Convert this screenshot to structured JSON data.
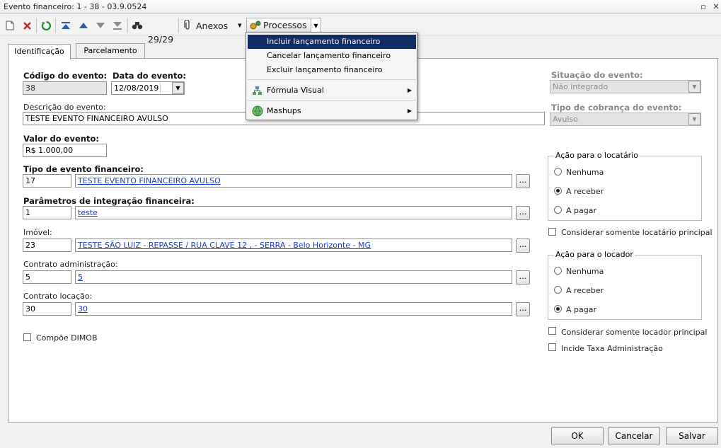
{
  "window": {
    "title": "Evento financeiro: 1 - 38 - 03.9.0524",
    "restore_glyph": "▫",
    "close_glyph": "✕"
  },
  "toolbar": {
    "record_position": "29/29",
    "attachments_label": "Anexos",
    "processes_label": "Processos"
  },
  "tabs": [
    "Identificação",
    "Parcelamento"
  ],
  "menu": {
    "items": [
      "Incluir lançamento financeiro",
      "Cancelar lançamento financeiro",
      "Excluir lançamento financeiro",
      "Fórmula Visual",
      "Mashups"
    ]
  },
  "form": {
    "codigo_label": "Código do evento:",
    "codigo_value": "38",
    "data_label": "Data do evento:",
    "data_value": "12/08/2019",
    "descricao_label": "Descrição do evento:",
    "descricao_value": "TESTE EVENTO FINANCEIRO AVULSO",
    "valor_label": "Valor do evento:",
    "valor_value": "R$ 1.000,00",
    "tipo_label": "Tipo de evento financeiro:",
    "tipo_code": "17",
    "tipo_desc": "TESTE EVENTO FINANCEIRO AVULSO",
    "param_label": "Parâmetros de integração financeira:",
    "param_code": "1",
    "param_desc": "teste",
    "imovel_label": "Imóvel:",
    "imovel_code": "23",
    "imovel_desc": "TESTE SÃO LUIZ - REPASSE / RUA CLAVE 12 ,  - SERRA - Belo Horizonte - MG",
    "contrato_adm_label": "Contrato administração:",
    "contrato_adm_code": "5",
    "contrato_adm_desc": "5",
    "contrato_loc_label": "Contrato locação:",
    "contrato_loc_code": "30",
    "contrato_loc_desc": "30",
    "dimob_label": "Compõe DIMOB",
    "situacao_label": "Situação do evento:",
    "situacao_value": "Não integrado",
    "cobranca_label": "Tipo de cobrança do evento:",
    "cobranca_value": "Avulso",
    "locatario_group": "Ação para o locatário",
    "locador_group": "Ação para o locador",
    "opt_nenhuma": "Nenhuma",
    "opt_receber": "A receber",
    "opt_pagar": "A pagar",
    "locatario_principal": "Considerar somente locatário principal",
    "locador_principal": "Considerar somente locador principal",
    "taxa_adm": "Incide Taxa Administração",
    "browse": "..."
  },
  "buttons": {
    "ok": "OK",
    "cancel": "Cancelar",
    "save": "Salvar"
  }
}
